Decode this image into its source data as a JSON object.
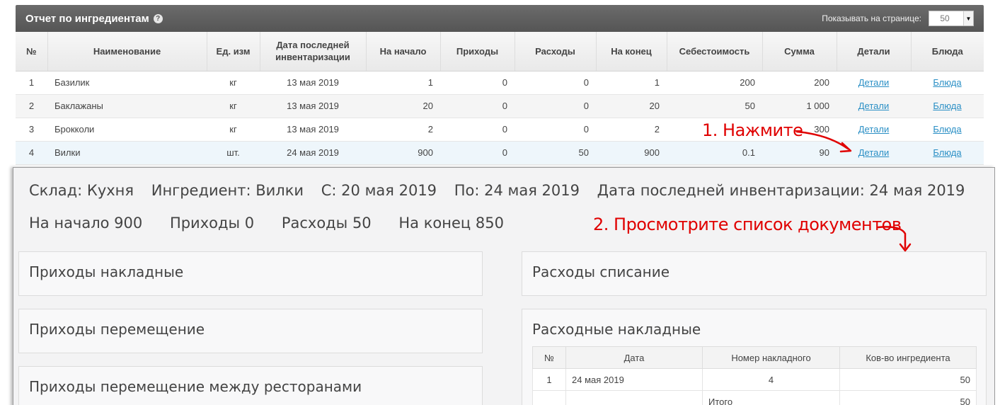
{
  "report": {
    "title": "Отчет по ингредиентам",
    "help_icon": "?",
    "per_page_label": "Показывать на странице:",
    "per_page_value": "50",
    "columns": [
      "№",
      "Наименование",
      "Ед. изм",
      "Дата последней инвентаризации",
      "На начало",
      "Приходы",
      "Расходы",
      "На конец",
      "Себестоимость",
      "Сумма",
      "Детали",
      "Блюда"
    ],
    "rows": [
      {
        "no": "1",
        "name": "Базилик",
        "unit": "кг",
        "date": "13 мая 2019",
        "start": "1",
        "income": "0",
        "expense": "0",
        "end": "1",
        "cost": "200",
        "sum": "200",
        "details": "Детали",
        "dishes": "Блюда"
      },
      {
        "no": "2",
        "name": "Баклажаны",
        "unit": "кг",
        "date": "13 мая 2019",
        "start": "20",
        "income": "0",
        "expense": "0",
        "end": "20",
        "cost": "50",
        "sum": "1 000",
        "details": "Детали",
        "dishes": "Блюда"
      },
      {
        "no": "3",
        "name": "Брокколи",
        "unit": "кг",
        "date": "13 мая 2019",
        "start": "2",
        "income": "0",
        "expense": "0",
        "end": "2",
        "cost": "",
        "sum": "300",
        "details": "Детали",
        "dishes": "Блюда"
      },
      {
        "no": "4",
        "name": "Вилки",
        "unit": "шт.",
        "date": "24 мая 2019",
        "start": "900",
        "income": "0",
        "expense": "50",
        "end": "900",
        "cost": "0.1",
        "sum": "90",
        "details": "Детали",
        "dishes": "Блюда"
      }
    ]
  },
  "annotations": {
    "step1": "1. Нажмите",
    "step2": "2. Просмотрите список документов",
    "color": "#e00000"
  },
  "details": {
    "warehouse": "Склад: Кухня",
    "ingredient": "Ингредиент: Вилки",
    "from": "С: 20 мая 2019",
    "to": "По: 24 мая 2019",
    "last_inventory": "Дата последней инвентаризации: 24 мая 2019",
    "start": "На начало 900",
    "income": "Приходы 0",
    "expense": "Расходы 50",
    "end": "На конец 850",
    "cards": {
      "income_invoices": "Приходы накладные",
      "income_transfer": "Приходы перемещение",
      "income_transfer_restaurants": "Приходы перемещение между ресторанами",
      "expense_writeoff": "Расходы списание",
      "expense_invoices": "Расходные накладные"
    },
    "docs_table": {
      "columns": [
        "№",
        "Дата",
        "Номер накладного",
        "Ков-во ингредиента"
      ],
      "rows": [
        {
          "no": "1",
          "date": "24 мая 2019",
          "number": "4",
          "qty": "50"
        }
      ],
      "total_label": "Итого",
      "total_value": "50"
    }
  }
}
